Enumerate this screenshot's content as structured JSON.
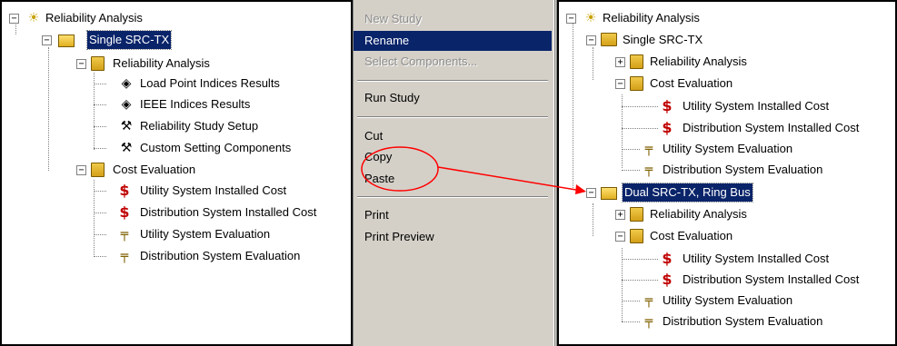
{
  "left_tree": {
    "root": "Reliability Analysis",
    "study": "Single SRC-TX",
    "reliability_folder": "Reliability Analysis",
    "reliability_items": [
      "Load Point Indices Results",
      "IEEE Indices Results",
      "Reliability Study Setup",
      "Custom Setting Components"
    ],
    "cost_folder": "Cost Evaluation",
    "cost_items": [
      "Utility System Installed Cost",
      "Distribution System Installed Cost",
      "Utility System Evaluation",
      "Distribution System Evaluation"
    ]
  },
  "context_menu": {
    "new_study": "New Study",
    "rename": "Rename",
    "select_components": "Select Components...",
    "run_study": "Run Study",
    "cut": "Cut",
    "copy": "Copy",
    "paste": "Paste",
    "print": "Print",
    "print_preview": "Print Preview"
  },
  "right_tree": {
    "root": "Reliability Analysis",
    "study1": "Single SRC-TX",
    "study1_reliability": "Reliability Analysis",
    "study1_cost": "Cost Evaluation",
    "study1_cost_items": [
      "Utility System Installed Cost",
      "Distribution System Installed Cost",
      "Utility System Evaluation",
      "Distribution System Evaluation"
    ],
    "study2": "Dual SRC-TX, Ring Bus",
    "study2_reliability": "Reliability Analysis",
    "study2_cost": "Cost Evaluation",
    "study2_cost_items": [
      "Utility System Installed Cost",
      "Distribution System Installed Cost",
      "Utility System Evaluation",
      "Distribution System Evaluation"
    ]
  },
  "colors": {
    "selection": "#0a246a",
    "annotation": "#ff0000",
    "dollar": "#c00000",
    "menu_bg": "#d4d0c8"
  },
  "icons": [
    "lightbulb-icon",
    "folder-open-icon",
    "folder-closed-icon",
    "diamond-doc-icon",
    "wrench-icon",
    "dollar-icon",
    "gauge-icon"
  ]
}
